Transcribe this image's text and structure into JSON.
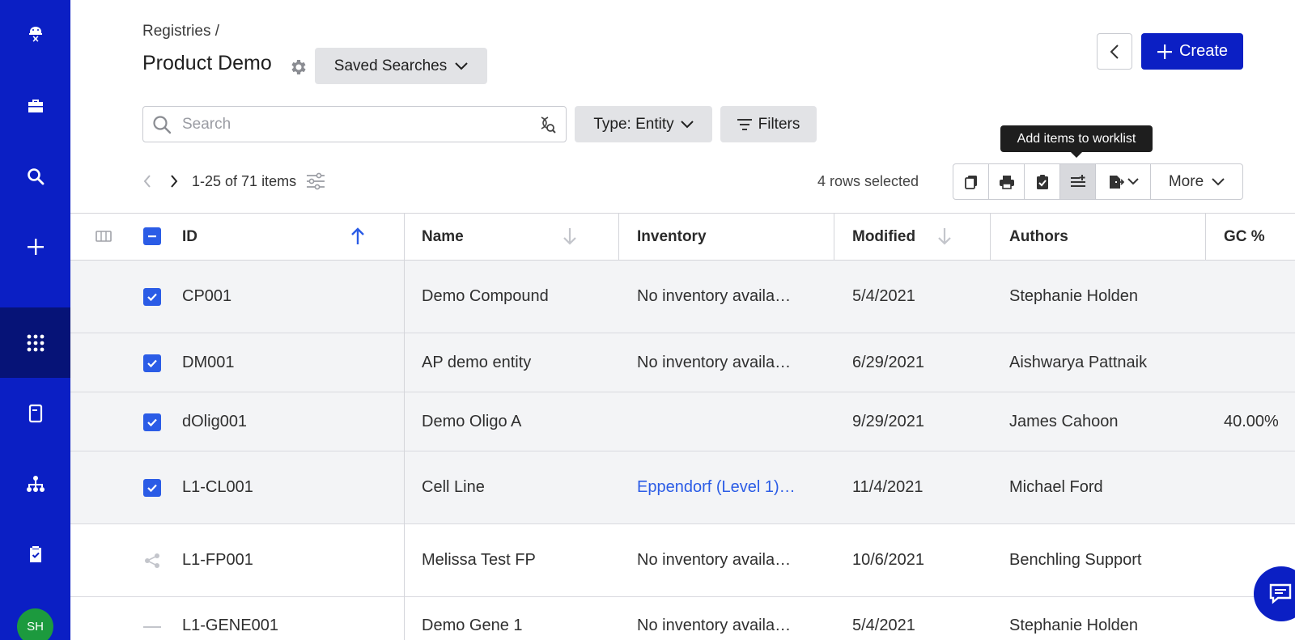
{
  "sidebar": {
    "icons": [
      "logo-icon",
      "briefcase-icon",
      "search-icon",
      "plus-icon",
      "apps-grid-icon",
      "notebook-icon",
      "hierarchy-icon",
      "clipboard-check-icon"
    ],
    "avatar_initials": "SH",
    "active_color": "#061377",
    "bg_color": "#0b1fc4"
  },
  "header": {
    "breadcrumb": "Registries /",
    "title": "Product Demo",
    "saved_searches_label": "Saved Searches",
    "create_label": "Create"
  },
  "search": {
    "placeholder": "Search",
    "type_label": "Type: Entity",
    "filters_label": "Filters"
  },
  "pagination": {
    "range_text": "1-25 of 71 items"
  },
  "selection": {
    "rows_selected_text": "4 rows selected"
  },
  "toolbar": {
    "tooltip": "Add items to worklist",
    "more_label": "More",
    "icons": [
      "copy-icon",
      "print-icon",
      "clipboard-check-icon",
      "add-to-worklist-icon",
      "export-icon"
    ]
  },
  "table": {
    "columns": {
      "id": "ID",
      "name": "Name",
      "inventory": "Inventory",
      "modified": "Modified",
      "authors": "Authors",
      "gc": "GC %"
    },
    "rows": [
      {
        "id": "CP001",
        "name": "Demo Compound",
        "inventory": "No inventory availa…",
        "modified": "5/4/2021",
        "authors": "Stephanie Holden",
        "gc": "",
        "selected": true
      },
      {
        "id": "DM001",
        "name": "AP demo entity",
        "inventory": "No inventory availa…",
        "modified": "6/29/2021",
        "authors": "Aishwarya Pattnaik",
        "gc": "",
        "selected": true
      },
      {
        "id": "dOlig001",
        "name": "Demo Oligo A",
        "inventory": "",
        "modified": "9/29/2021",
        "authors": "James Cahoon",
        "gc": "40.00%",
        "selected": true
      },
      {
        "id": "L1-CL001",
        "name": "Cell Line",
        "inventory": "Eppendorf (Level 1)…",
        "modified": "11/4/2021",
        "authors": "Michael Ford",
        "gc": "",
        "selected": true
      },
      {
        "id": "L1-FP001",
        "name": "Melissa Test FP",
        "inventory": "No inventory availa…",
        "modified": "10/6/2021",
        "authors": "Benchling Support",
        "gc": "",
        "selected": false
      },
      {
        "id": "L1-GENE001",
        "name": "Demo Gene 1",
        "inventory": "No inventory availa…",
        "modified": "5/4/2021",
        "authors": "Stephanie Holden",
        "gc": "",
        "selected": false
      }
    ]
  },
  "colors": {
    "brand": "#0b1fc4",
    "checkbox": "#2b5ce6",
    "link": "#2b5ce6"
  }
}
